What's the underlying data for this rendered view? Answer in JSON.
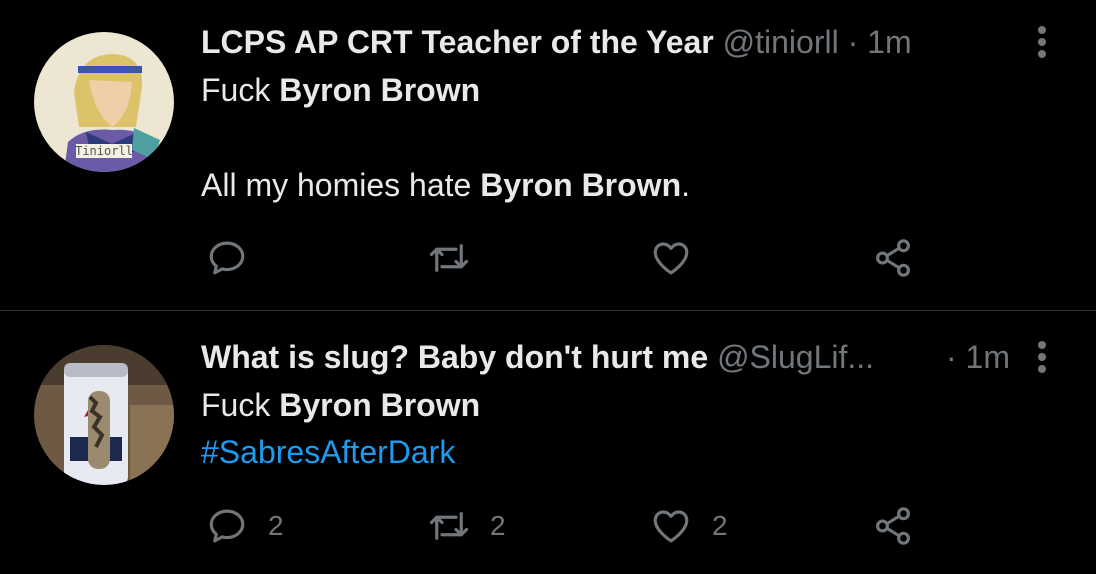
{
  "tweets": [
    {
      "display_name": "LCPS AP CRT Teacher of the Year",
      "handle": "@tiniorll",
      "time": "1m",
      "avatar_label": "Tiniorll",
      "line1": {
        "prefix": "Fuck ",
        "bold": "Byron Brown"
      },
      "line2": {
        "prefix": "All my homies hate ",
        "bold": "Byron Brown",
        "suffix": "."
      },
      "actions": {
        "reply": "",
        "retweet": "",
        "like": ""
      }
    },
    {
      "display_name": "What is slug? Baby don't hurt me",
      "handle": "@SlugLif...",
      "time": "1m",
      "line1": {
        "prefix": "Fuck ",
        "bold": "Byron Brown"
      },
      "hashtag": "#SabresAfterDark",
      "actions": {
        "reply": "2",
        "retweet": "2",
        "like": "2"
      }
    }
  ],
  "colors": {
    "background": "#000000",
    "text": "#e7e9ea",
    "muted": "#71767b",
    "link": "#1d9bf0",
    "divider": "#2f3336"
  }
}
